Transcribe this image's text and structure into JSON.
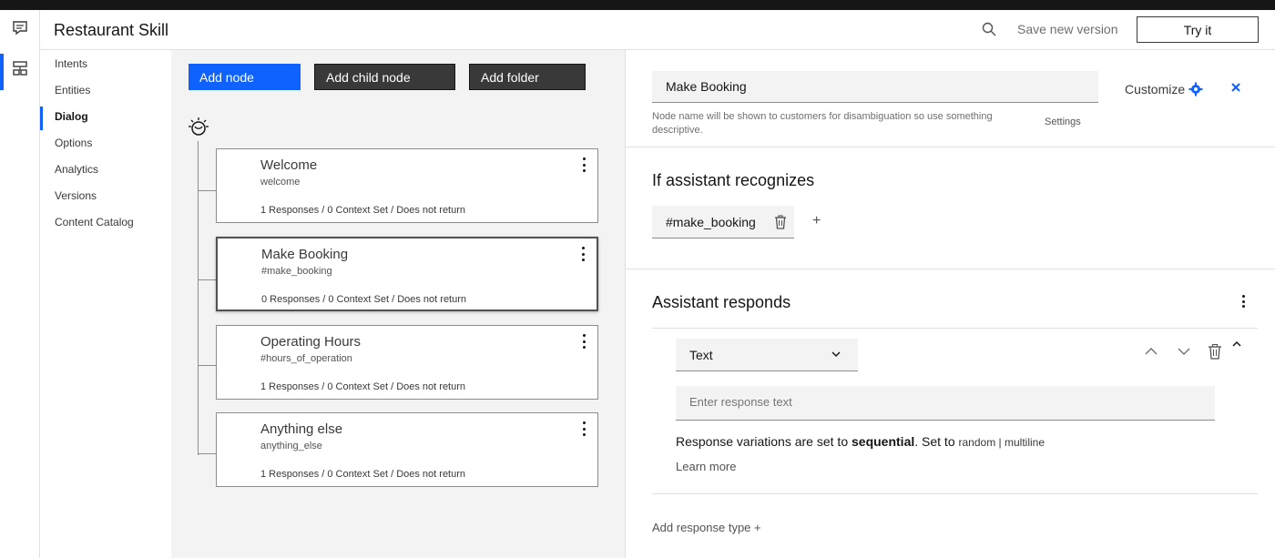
{
  "header": {
    "title": "Restaurant Skill",
    "save_version": "Save new version",
    "try_it": "Try it"
  },
  "rail": {
    "icons": [
      "chat-icon",
      "skills-icon"
    ]
  },
  "nav": {
    "items": [
      {
        "label": "Intents"
      },
      {
        "label": "Entities"
      },
      {
        "label": "Dialog",
        "active": true
      },
      {
        "label": "Options"
      },
      {
        "label": "Analytics"
      },
      {
        "label": "Versions"
      },
      {
        "label": "Content Catalog"
      }
    ]
  },
  "toolbar": {
    "add_node": "Add node",
    "add_child_node": "Add child node",
    "add_folder": "Add folder"
  },
  "nodes": [
    {
      "title": "Welcome",
      "condition": "welcome",
      "meta": "1 Responses / 0 Context Set / Does not return"
    },
    {
      "title": "Make Booking",
      "condition": "#make_booking",
      "meta": "0 Responses / 0 Context Set / Does not return",
      "selected": true
    },
    {
      "title": "Operating Hours",
      "condition": "#hours_of_operation",
      "meta": "1 Responses / 0 Context Set / Does not return"
    },
    {
      "title": "Anything else",
      "condition": "anything_else",
      "meta": "1 Responses / 0 Context Set / Does not return"
    }
  ],
  "editor": {
    "node_name": "Make Booking",
    "helper_text": "Node name will be shown to customers for disambiguation so use something descriptive.",
    "customize": "Customize",
    "settings": "Settings",
    "recognizes_title": "If assistant recognizes",
    "intent": "#make_booking",
    "add_condition": "+",
    "responds_title": "Assistant responds",
    "response_type": "Text",
    "response_placeholder": "Enter response text",
    "variations_prefix": "Response variations are set to ",
    "variations_mode": "sequential",
    "variations_mid": ". Set to ",
    "variations_opt1": "random",
    "variations_sep": " | ",
    "variations_opt2": "multiline",
    "learn_more": "Learn more",
    "add_response_type": "Add response type",
    "add_response_plus": "+"
  },
  "colors": {
    "primary": "#0f62fe",
    "dark_button": "#393939",
    "topbar": "#161616"
  }
}
